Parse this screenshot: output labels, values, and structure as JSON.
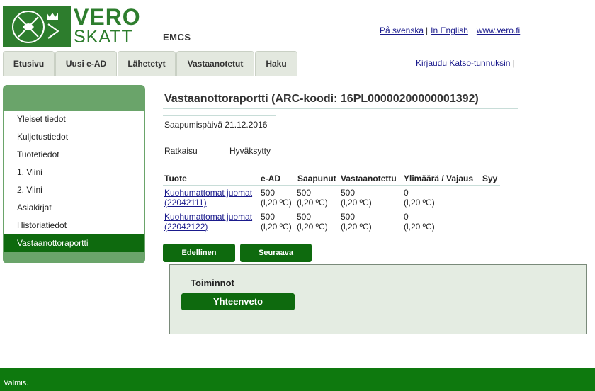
{
  "logo": {
    "line1": "VERO",
    "line2": "SKATT"
  },
  "app_title": "EMCS",
  "top_links": {
    "swedish": "På svenska",
    "english": "In English",
    "site": "www.vero.fi",
    "separator": "|"
  },
  "tabs": [
    {
      "label": "Etusivu"
    },
    {
      "label": "Uusi e-AD"
    },
    {
      "label": "Lähetetyt"
    },
    {
      "label": "Vastaanotetut"
    },
    {
      "label": "Haku"
    }
  ],
  "login": {
    "label": "Kirjaudu Katso-tunnuksin",
    "separator": "|"
  },
  "sidebar": {
    "items": [
      {
        "label": "Yleiset tiedot"
      },
      {
        "label": "Kuljetustiedot"
      },
      {
        "label": "Tuotetiedot"
      },
      {
        "label": "1. Viini"
      },
      {
        "label": "2. Viini"
      },
      {
        "label": "Asiakirjat"
      },
      {
        "label": "Historiatiedot"
      },
      {
        "label": "Vastaanottoraportti"
      }
    ],
    "active": "Vastaanottoraportti"
  },
  "report": {
    "title": "Vastaanottoraportti (ARC-koodi: 16PL00000200000001392)",
    "arrival": "Saapumispäivä 21.12.2016",
    "decision_label": "Ratkaisu",
    "decision_value": "Hyväksytty"
  },
  "table": {
    "headers": [
      "Tuote",
      "e-AD",
      "Saapunut",
      "Vastaanotettu",
      "Ylimäärä / Vajaus",
      "Syy"
    ],
    "rows": [
      {
        "product": "Kuohumattomat juomat",
        "code": "(22042111)",
        "ead": "500",
        "arrived": "500",
        "received": "500",
        "diff": "0",
        "unit": "(l,20 ºC)",
        "reason": ""
      },
      {
        "product": "Kuohumattomat juomat",
        "code": "(22042122)",
        "ead": "500",
        "arrived": "500",
        "received": "500",
        "diff": "0",
        "unit": "(l,20 ºC)",
        "reason": ""
      }
    ]
  },
  "buttons": {
    "previous": "Edellinen",
    "next": "Seuraava"
  },
  "actions": {
    "title": "Toiminnot",
    "summary": "Yhteenveto"
  },
  "status_text": "Valmis.",
  "colors": {
    "brand_green": "#2d7d2d",
    "active_green": "#0e6a0e",
    "link_blue": "#1a1a8c",
    "panel_bg": "#e4ece2"
  }
}
